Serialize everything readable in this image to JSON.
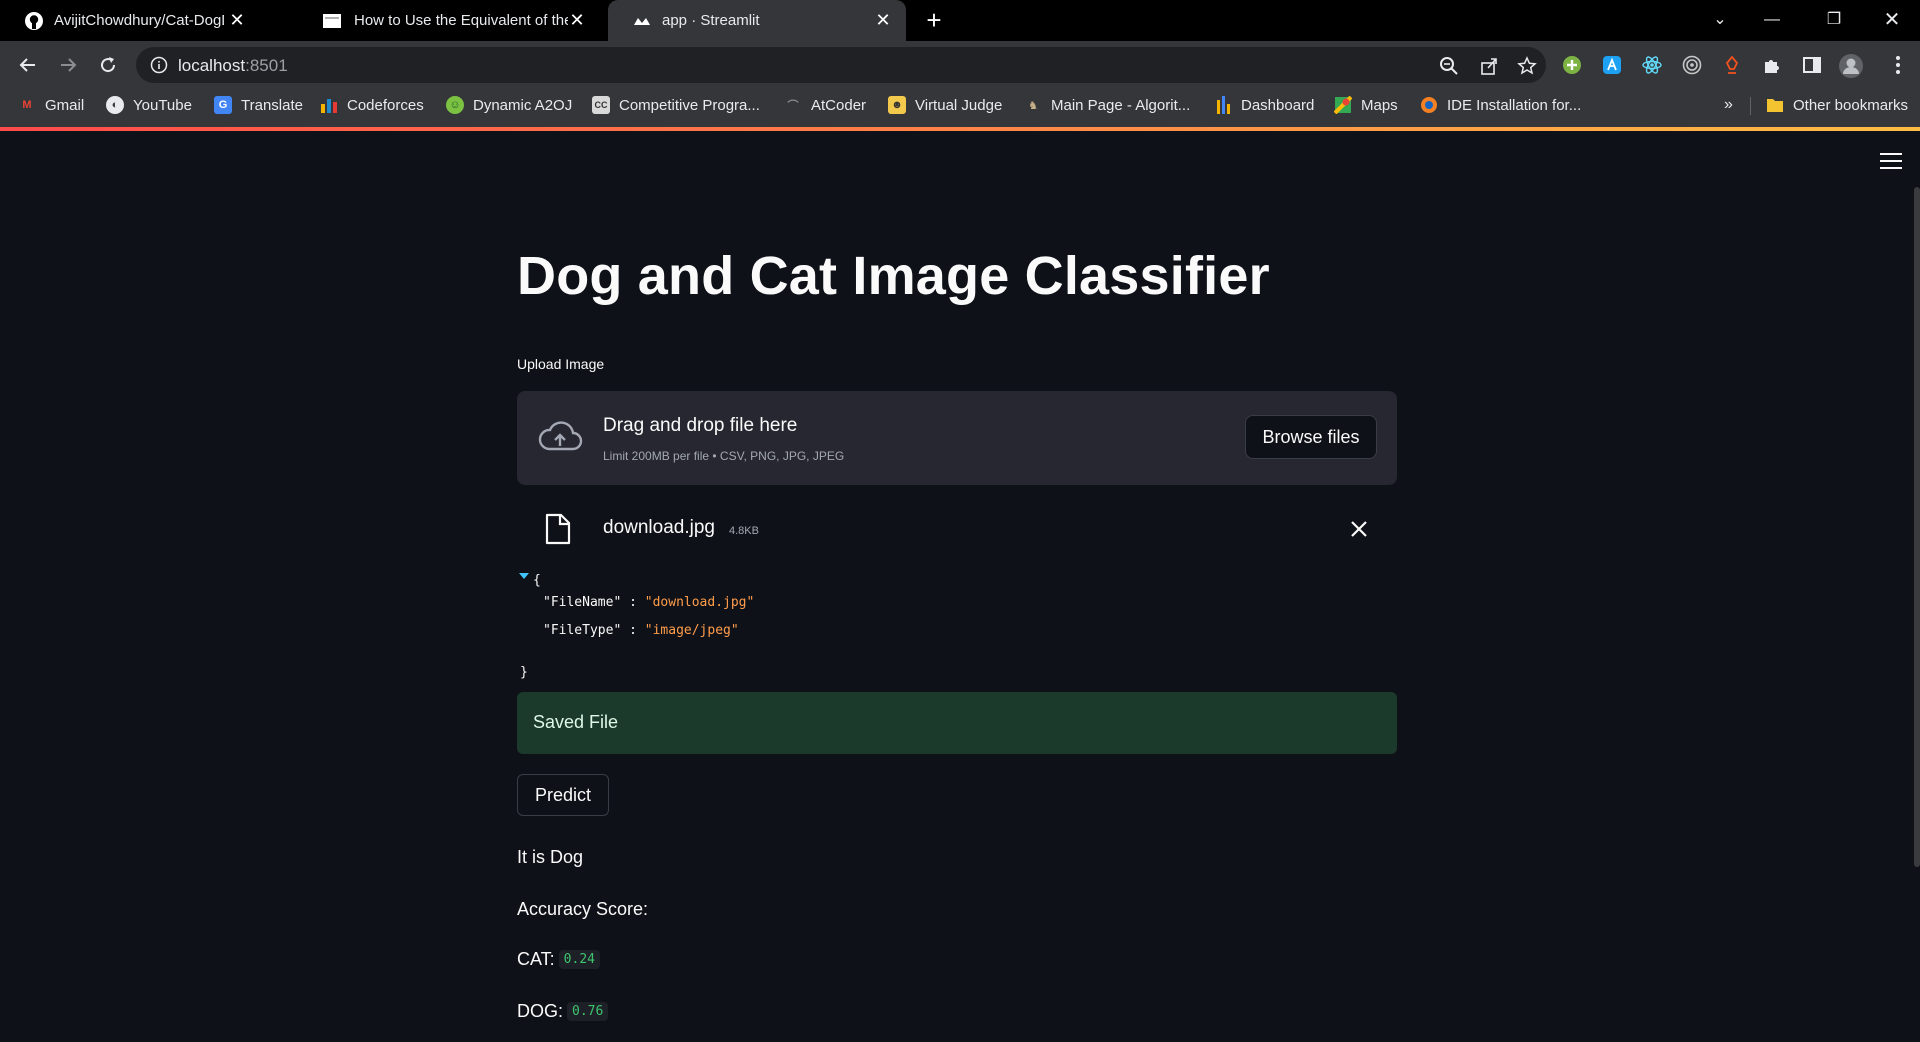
{
  "browser": {
    "tabs": [
      {
        "title": "AvijitChowdhury/Cat-DogDetect",
        "icon": "github-icon"
      },
      {
        "title": "How to Use the Equivalent of the",
        "icon": "page-icon"
      },
      {
        "title": "app · Streamlit",
        "icon": "streamlit-icon",
        "active": true
      }
    ],
    "url_host": "localhost",
    "url_port": ":8501",
    "bookmarks": [
      {
        "label": "Gmail",
        "icon": "gmail-icon",
        "color": "#ea4335"
      },
      {
        "label": "YouTube",
        "icon": "globe-icon",
        "color": "#e8eaed"
      },
      {
        "label": "Translate",
        "icon": "translate-icon",
        "color": "#4285f4"
      },
      {
        "label": "Codeforces",
        "icon": "codeforces-icon",
        "color": "#1f8acb"
      },
      {
        "label": "Dynamic A2OJ",
        "icon": "a2oj-icon",
        "color": "#7cc142"
      },
      {
        "label": "Competitive Progra...",
        "icon": "cc-icon",
        "color": "#d9d9d9"
      },
      {
        "label": "AtCoder",
        "icon": "atcoder-icon",
        "color": "#8a8a8a"
      },
      {
        "label": "Virtual Judge",
        "icon": "vjudge-icon",
        "color": "#f2c94c"
      },
      {
        "label": "Main Page - Algorit...",
        "icon": "algorithm-icon",
        "color": "#c8b28a"
      },
      {
        "label": "Dashboard",
        "icon": "dashboard-icon",
        "color": "#f4b400"
      },
      {
        "label": "Maps",
        "icon": "maps-icon",
        "color": "#34a853"
      },
      {
        "label": "IDE Installation for...",
        "icon": "ide-icon",
        "color": "#f48024"
      }
    ],
    "other_bookmarks": "Other bookmarks"
  },
  "app": {
    "title": "Dog and Cat Image Classifier",
    "upload_label": "Upload Image",
    "dropzone_title": "Drag and drop file here",
    "dropzone_limit": "Limit 200MB per file • CSV, PNG, JPG, JPEG",
    "browse_label": "Browse files",
    "file_name": "download.jpg",
    "file_size": "4.8KB",
    "json": {
      "open": "{",
      "close": "}",
      "line1_key": "\"FileName\"",
      "line1_sep": " : ",
      "line1_val": "\"download.jpg\"",
      "line2_key": "\"FileType\"",
      "line2_sep": " : ",
      "line2_val": "\"image/jpeg\""
    },
    "success_text": "Saved File",
    "predict_label": "Predict",
    "result": "It is Dog",
    "accuracy_label": "Accuracy Score:",
    "cat_label": "CAT:",
    "cat_score": "0.24",
    "dog_label": "DOG:",
    "dog_score": "0.76"
  },
  "colors": {
    "background": "#0e1117",
    "success_bg": "#1b3a2b",
    "accent_red": "#ff4b4b",
    "code_green": "#3ec46d",
    "json_string": "#ff9d4b"
  }
}
